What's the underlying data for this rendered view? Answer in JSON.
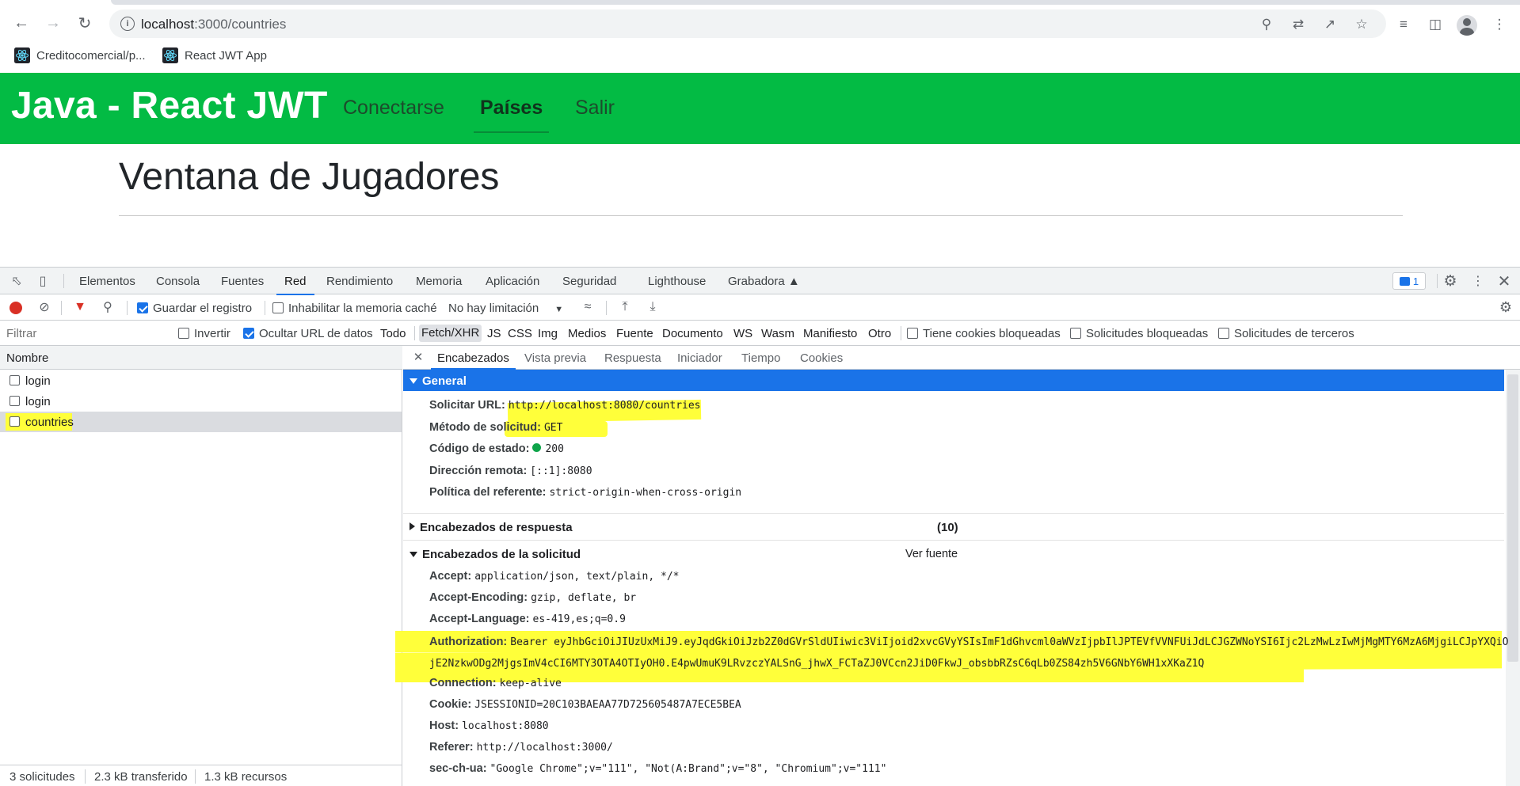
{
  "browser": {
    "url_host": "localhost",
    "url_rest": ":3000/countries",
    "bookmarks": [
      {
        "label": "Creditocomercial/p..."
      },
      {
        "label": "React JWT App"
      }
    ]
  },
  "app": {
    "brand": "Java - React JWT",
    "nav": [
      {
        "label": "Conectarse"
      },
      {
        "label": "Países"
      },
      {
        "label": "Salir"
      }
    ],
    "page_title": "Ventana de Jugadores"
  },
  "devtools": {
    "tabs": [
      "Elementos",
      "Consola",
      "Fuentes",
      "Red",
      "Rendimiento",
      "Memoria",
      "Aplicación",
      "Seguridad",
      "Lighthouse",
      "Grabadora"
    ],
    "issues_count": "1",
    "toolbar": {
      "preserve_log": "Guardar el registro",
      "disable_cache": "Inhabilitar la memoria caché",
      "throttling": "No hay limitación"
    },
    "filter": {
      "placeholder": "Filtrar",
      "invert": "Invertir",
      "hide_data_urls": "Ocultar URL de datos",
      "types": [
        "Todo",
        "Fetch/XHR",
        "JS",
        "CSS",
        "Img",
        "Medios",
        "Fuente",
        "Documento",
        "WS",
        "Wasm",
        "Manifiesto",
        "Otro"
      ],
      "blocked_cookies": "Tiene cookies bloqueadas",
      "blocked_requests": "Solicitudes bloqueadas",
      "third_party": "Solicitudes de terceros"
    },
    "request_list": {
      "header": "Nombre",
      "rows": [
        {
          "name": "login"
        },
        {
          "name": "login"
        },
        {
          "name": "countries"
        }
      ],
      "footer": {
        "requests": "3 solicitudes",
        "transferred": "2.3 kB transferido",
        "resources": "1.3 kB recursos"
      }
    },
    "details": {
      "tabs": [
        "Encabezados",
        "Vista previa",
        "Respuesta",
        "Iniciador",
        "Tiempo",
        "Cookies"
      ],
      "general": {
        "title": "General",
        "request_url_key": "Solicitar URL:",
        "request_url": "http://localhost:8080/countries",
        "method_key": "Método de solicitud:",
        "method": "GET",
        "status_key": "Código de estado:",
        "status": "200",
        "remote_key": "Dirección remota:",
        "remote": "[::1]:8080",
        "referrer_policy_key": "Política del referente:",
        "referrer_policy": "strict-origin-when-cross-origin"
      },
      "response_headers": {
        "title": "Encabezados de respuesta",
        "count": "(10)"
      },
      "request_headers": {
        "title": "Encabezados de la solicitud",
        "view_source": "Ver fuente",
        "items": [
          {
            "key": "Accept:",
            "value": "application/json, text/plain, */*"
          },
          {
            "key": "Accept-Encoding:",
            "value": "gzip, deflate, br"
          },
          {
            "key": "Accept-Language:",
            "value": "es-419,es;q=0.9"
          }
        ],
        "authorization_key": "Authorization:",
        "authorization_value": "Bearer eyJhbGciOiJIUzUxMiJ9.eyJqdGkiOiJzb2Z0dGVrSldUIiwic3ViIjoid2xvcGVyYSIsImF1dGhvcml0aWVzIjpbIlJPTEVfVVNFUiJdLCJGZWNoYSI6Ijc2LzMwLzIwMjMgMTY6MzA6MjgiLCJpYXQiOjE2NzkwODg2MjgsImV4cCI6MTY3OTA4OTIyOH0.E4pwUmuK9LRvzczYALSnG_jhwX_FCTaZJ0VCcn2JiD0FkwJ_obsbbRZsC6qLb0ZS84zh5V6GNbY6WH1xXKaZ1Q",
        "items_after": [
          {
            "key": "Connection:",
            "value": "keep-alive"
          },
          {
            "key": "Cookie:",
            "value": "JSESSIONID=20C103BAEAA77D725605487A7ECE5BEA"
          },
          {
            "key": "Host:",
            "value": "localhost:8080"
          },
          {
            "key": "Referer:",
            "value": "http://localhost:3000/"
          },
          {
            "key": "sec-ch-ua:",
            "value": "\"Google Chrome\";v=\"111\", \"Not(A:Brand\";v=\"8\", \"Chromium\";v=\"111\""
          }
        ]
      }
    }
  }
}
